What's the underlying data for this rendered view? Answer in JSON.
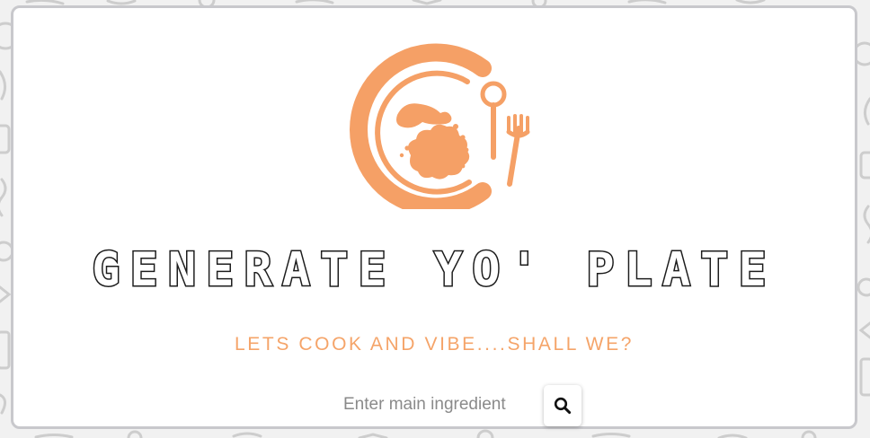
{
  "header": {
    "title": "GENERATE YO' PLATE",
    "tagline": "LETS COOK AND VIBE....SHALL WE?"
  },
  "logo": {
    "icon": "plate-spoon-fork-logo-icon",
    "color": "#f5a066"
  },
  "search": {
    "placeholder": "Enter main ingredient",
    "value": "",
    "button_icon": "search-icon"
  },
  "colors": {
    "accent": "#f5a066",
    "tagline": "#f5a469",
    "title_outline": "#1c1c1c",
    "card_border": "#c8c8cc",
    "background": "#f1f1f1"
  }
}
